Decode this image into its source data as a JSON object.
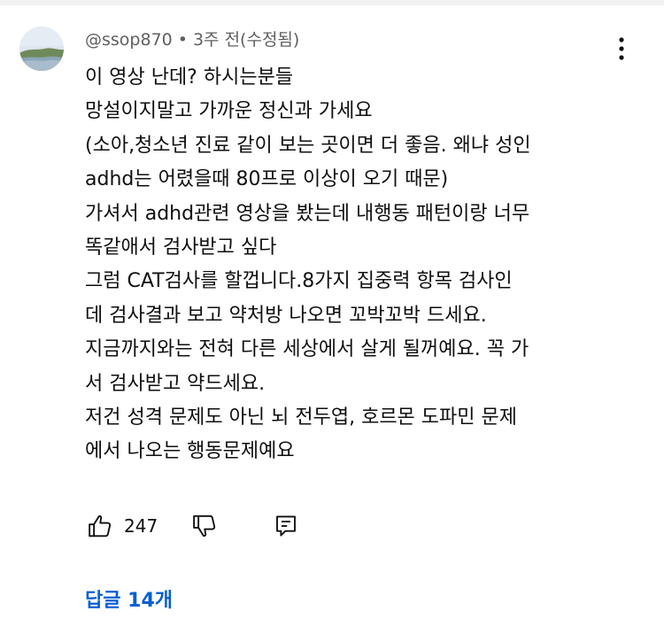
{
  "comment": {
    "author": "@ssop870",
    "separator": "•",
    "time": "3주 전(수정됨)",
    "lines": [
      "이 영상 난데? 하시는분들",
      "망설이지말고 가까운 정신과 가세요",
      "(소아,청소년 진료 같이 보는 곳이면 더 좋음. 왜냐 성인",
      "adhd는 어렸을때 80프로 이상이 오기 때문)",
      "가셔서 adhd관련 영상을 봤는데 내행동 패턴이랑 너무",
      "똑같애서 검사받고 싶다",
      "그럼 CAT검사를 할껍니다.8가지 집중력 항목 검사인",
      "데 검사결과 보고 약처방 나오면 꼬박꼬박 드세요.",
      "지금까지와는 전혀 다른 세상에서 살게 될꺼예요. 꼭 가",
      "서 검사받고 약드세요.",
      "저건 성격 문제도 아닌 뇌 전두엽, 호르몬 도파민 문제",
      "에서 나오는 행동문제예요"
    ]
  },
  "actions": {
    "like_count": "247",
    "like_icon": "thumbs-up-icon",
    "dislike_icon": "thumbs-down-icon",
    "reply_icon": "reply-icon"
  },
  "replies": {
    "label": "답글 14개"
  },
  "colors": {
    "link": "#065fd4",
    "meta": "#606060",
    "text": "#0f0f0f"
  }
}
